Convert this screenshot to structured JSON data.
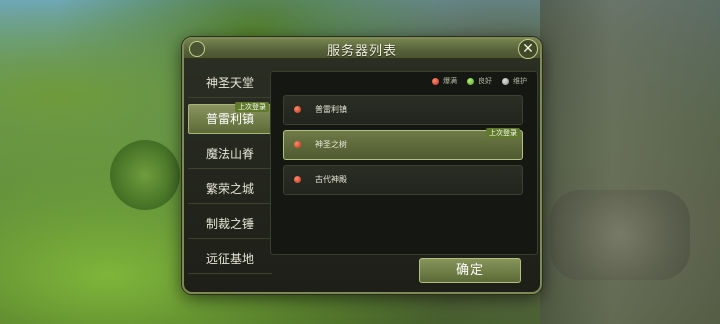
{
  "dialog": {
    "title": "服务器列表",
    "close_icon": "close-icon"
  },
  "sidebar": {
    "items": [
      {
        "label": "神圣天堂",
        "active": false
      },
      {
        "label": "普雷利镇",
        "active": true,
        "tag": "上次登录"
      },
      {
        "label": "魔法山脊",
        "active": false
      },
      {
        "label": "繁荣之城",
        "active": false
      },
      {
        "label": "制裁之锤",
        "active": false
      },
      {
        "label": "远征基地",
        "active": false
      }
    ]
  },
  "legend": {
    "items": [
      {
        "label": "爆满",
        "color": "#c2321e"
      },
      {
        "label": "良好",
        "color": "#4e9d20"
      },
      {
        "label": "维护",
        "color": "#8c8c8c"
      }
    ]
  },
  "servers": [
    {
      "name": "普雷利镇",
      "status": "爆满",
      "selected": false
    },
    {
      "name": "神圣之树",
      "status": "爆满",
      "selected": true,
      "tag": "上次登录"
    },
    {
      "name": "古代神殿",
      "status": "爆满",
      "selected": false
    }
  ],
  "confirm_label": "确定"
}
